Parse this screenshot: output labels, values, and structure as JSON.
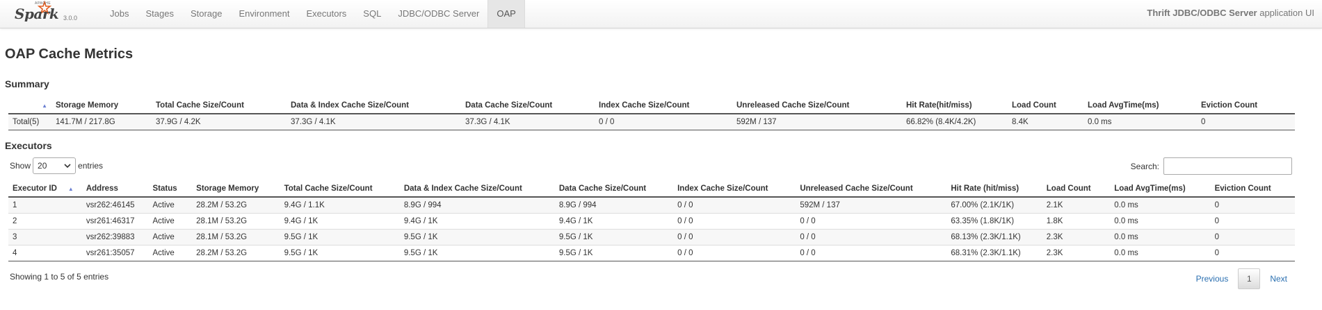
{
  "navbar": {
    "brand": {
      "apache": "APACHE",
      "word": "Spark",
      "version": "3.0.0"
    },
    "items": [
      {
        "label": "Jobs"
      },
      {
        "label": "Stages"
      },
      {
        "label": "Storage"
      },
      {
        "label": "Environment"
      },
      {
        "label": "Executors"
      },
      {
        "label": "SQL"
      },
      {
        "label": "JDBC/ODBC Server"
      },
      {
        "label": "OAP",
        "active": true
      }
    ],
    "app_title_bold": "Thrift JDBC/ODBC Server",
    "app_title_rest": " application UI"
  },
  "page_title": "OAP Cache Metrics",
  "summary": {
    "heading": "Summary",
    "headers": [
      "Storage Memory",
      "Total Cache Size/Count",
      "Data & Index Cache Size/Count",
      "Data Cache Size/Count",
      "Index Cache Size/Count",
      "Unreleased Cache Size/Count",
      "Hit Rate(hit/miss)",
      "Load Count",
      "Load AvgTime(ms)",
      "Eviction Count"
    ],
    "row": [
      "Total(5)",
      "141.7M / 217.8G",
      "37.9G / 4.2K",
      "37.3G / 4.1K",
      "37.3G / 4.1K",
      "0 / 0",
      "592M / 137",
      "66.82% (8.4K/4.2K)",
      "8.4K",
      "0.0 ms",
      "0"
    ]
  },
  "executors": {
    "heading": "Executors",
    "show_label": "Show",
    "page_size": "20",
    "entries_label": "entries",
    "search_label": "Search:",
    "headers": [
      "Executor ID",
      "Address",
      "Status",
      "Storage Memory",
      "Total Cache Size/Count",
      "Data & Index Cache Size/Count",
      "Data Cache Size/Count",
      "Index Cache Size/Count",
      "Unreleased Cache Size/Count",
      "Hit Rate (hit/miss)",
      "Load Count",
      "Load AvgTime(ms)",
      "Eviction Count"
    ],
    "rows": [
      [
        "1",
        "vsr262:46145",
        "Active",
        "28.2M / 53.2G",
        "9.4G / 1.1K",
        "8.9G / 994",
        "8.9G / 994",
        "0 / 0",
        "592M / 137",
        "67.00% (2.1K/1K)",
        "2.1K",
        "0.0 ms",
        "0"
      ],
      [
        "2",
        "vsr261:46317",
        "Active",
        "28.1M / 53.2G",
        "9.4G / 1K",
        "9.4G / 1K",
        "9.4G / 1K",
        "0 / 0",
        "0 / 0",
        "63.35% (1.8K/1K)",
        "1.8K",
        "0.0 ms",
        "0"
      ],
      [
        "3",
        "vsr262:39883",
        "Active",
        "28.1M / 53.2G",
        "9.5G / 1K",
        "9.5G / 1K",
        "9.5G / 1K",
        "0 / 0",
        "0 / 0",
        "68.13% (2.3K/1.1K)",
        "2.3K",
        "0.0 ms",
        "0"
      ],
      [
        "4",
        "vsr261:35057",
        "Active",
        "28.2M / 53.2G",
        "9.5G / 1K",
        "9.5G / 1K",
        "9.5G / 1K",
        "0 / 0",
        "0 / 0",
        "68.31% (2.3K/1.1K)",
        "2.3K",
        "0.0 ms",
        "0"
      ]
    ],
    "showing_text": "Showing 1 to 5 of 5 entries",
    "pager": {
      "previous": "Previous",
      "current": "1",
      "next": "Next"
    }
  },
  "colors": {
    "link": "#2a6fb0",
    "sort_arrow": "#6a7fd2",
    "spark_orange": "#e25a1c"
  }
}
